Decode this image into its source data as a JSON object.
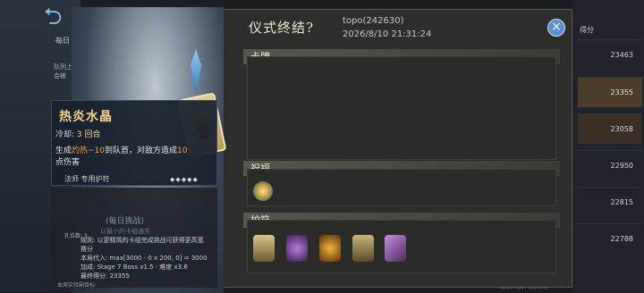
{
  "background": {
    "side_label": "每日",
    "side_note": "队列上会被",
    "leaderboard_header": "得分",
    "leaderboard_scores": [
      "23463",
      "23355",
      "23058",
      "22950",
      "22815",
      "22788"
    ],
    "version": "PID164184 1.0.5.6"
  },
  "modal": {
    "title": "仪式终结?",
    "user": "topo(242630)",
    "timestamp": "2026/8/10 21:31:24",
    "close_label": "×",
    "sections": {
      "cards": "卡牌",
      "blessing": "祝福",
      "amulets": "护符"
    },
    "blessing_icon": "wings-emblem-icon",
    "amulet_icons": [
      "armor-icon",
      "claw-icon",
      "flame-crystal-icon",
      "scales-icon",
      "staff-icon"
    ]
  },
  "tooltip": {
    "name": "热炎水晶",
    "cooldown_label": "冷却:",
    "cooldown_value": "3 回合",
    "desc_prefix": "生成",
    "desc_hl1": "灼热~10",
    "desc_mid": "到队首，对敌方造成",
    "desc_hl2": "10",
    "desc_suffix": "点伤害",
    "class_label": "法师 专用护符"
  },
  "challenge": {
    "title": "(每日挑战)",
    "subtitle": "以最小的卡组通关",
    "slots": "孔位数: 3",
    "rule1": "规则: 以更精简的卡组完成挑战可获得更高宽",
    "rule1b": "赛分",
    "rule2": "本局代入: max[3000 - 0 x 200, 0] = 3000",
    "rule3": "加成: Stage 7 Boss x1.5 · 难度 x3.6",
    "rule4": "最终得分: 23355",
    "footer": "本周实验副目标:"
  },
  "colors": {
    "accent_gold": "#f4d48c",
    "highlight_orange": "#f2a344",
    "close_blue": "#5b8fd1"
  }
}
